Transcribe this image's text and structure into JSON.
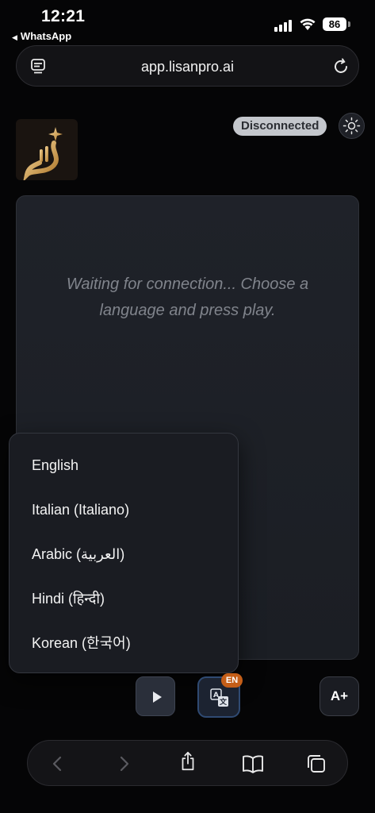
{
  "status_bar": {
    "time": "12:21",
    "back_app": "WhatsApp",
    "battery": "86"
  },
  "browser": {
    "url": "app.lisanpro.ai"
  },
  "header": {
    "connection_status": "Disconnected",
    "status_color": "#c4c7cc"
  },
  "panel": {
    "message": "Waiting for connection... Choose a language and press play."
  },
  "language_menu": {
    "options": [
      "English",
      "Italian (Italiano)",
      "Arabic (العربية)",
      "Hindi (हिन्दी)",
      "Korean (한국어)"
    ]
  },
  "controls": {
    "language_code": "EN",
    "font_size_label": "A+",
    "accent_color": "#c45e18"
  },
  "icons": {
    "tabs": "tabs-icon",
    "reload": "reload-icon",
    "theme": "sun-icon",
    "play": "play-icon",
    "translate": "translate-icon",
    "back": "chevron-left-icon",
    "forward": "chevron-right-icon",
    "share": "share-icon",
    "bookmarks": "book-icon",
    "pages": "tabs-overview-icon"
  }
}
